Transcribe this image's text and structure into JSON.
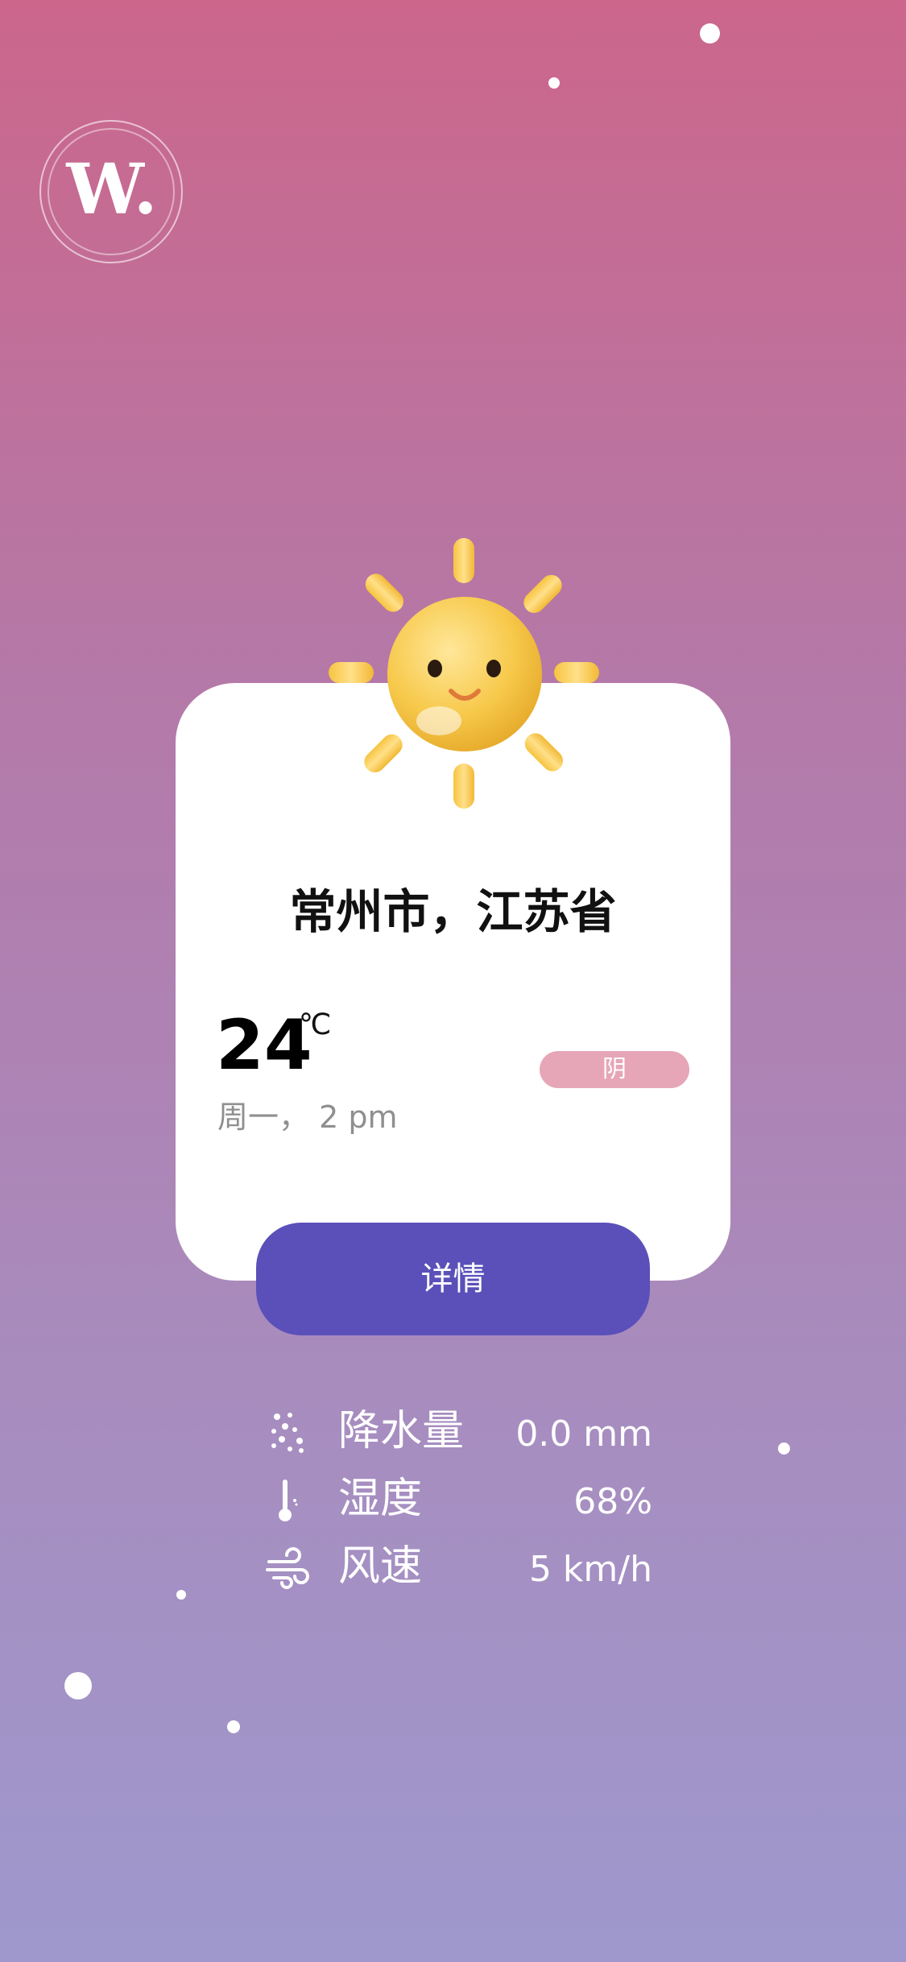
{
  "app": {
    "logo_text": "W."
  },
  "location": {
    "city": "常州市，江苏省"
  },
  "weather": {
    "temperature": "24",
    "unit": "℃",
    "datetime": "周一， 2 pm",
    "condition": "阴",
    "icon": "smiling-sun-icon"
  },
  "actions": {
    "details_label": "详情"
  },
  "stats": [
    {
      "icon": "precipitation-icon",
      "label": "降水量",
      "value": "0.0 mm"
    },
    {
      "icon": "thermometer-icon",
      "label": "湿度",
      "value": "68%"
    },
    {
      "icon": "wind-icon",
      "label": "风速",
      "value": "5 km/h"
    }
  ],
  "colors": {
    "background_top": "#cc668b",
    "background_bottom": "#9e98cd",
    "button": "#5b50b9",
    "badge": "#e6a6b8"
  }
}
